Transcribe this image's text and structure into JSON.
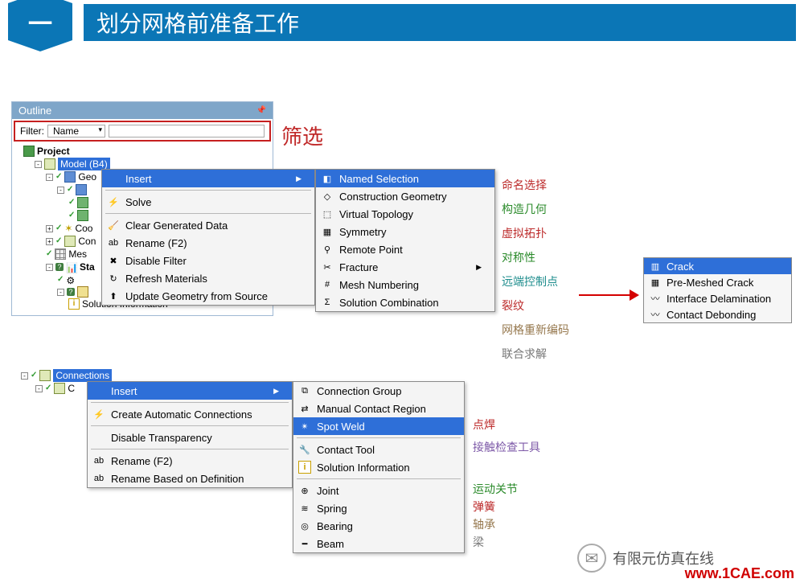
{
  "header": {
    "badge": "一",
    "title": "划分网格前准备工作"
  },
  "outline": {
    "title": "Outline",
    "filter_label": "Filter:",
    "filter_name": "Name",
    "project": "Project",
    "model": "Model (B4)",
    "geo": "Geo",
    "coo": "Coo",
    "con": "Con",
    "mes": "Mes",
    "sta": "Sta",
    "sol_info": "Solution Information"
  },
  "filter_anno": "筛选",
  "menu1": {
    "insert": "Insert",
    "solve": "Solve",
    "clear": "Clear Generated Data",
    "rename": "Rename (F2)",
    "disable_filter": "Disable Filter",
    "refresh": "Refresh Materials",
    "update_geom": "Update Geometry from Source"
  },
  "submenu1": {
    "named_sel": "Named Selection",
    "constr_geom": "Construction Geometry",
    "virt_topo": "Virtual Topology",
    "symmetry": "Symmetry",
    "remote_pt": "Remote Point",
    "fracture": "Fracture",
    "mesh_num": "Mesh Numbering",
    "sol_comb": "Solution Combination"
  },
  "anno1": {
    "named_sel": "命名选择",
    "constr_geom": "构造几何",
    "virt_topo": "虚拟拓扑",
    "symmetry": "对称性",
    "remote_pt": "远端控制点",
    "fracture": "裂纹",
    "mesh_num": "网格重新编码",
    "sol_comb": "联合求解"
  },
  "crack_menu": {
    "crack": "Crack",
    "premesh": "Pre-Meshed Crack",
    "delam": "Interface Delamination",
    "debond": "Contact Debonding"
  },
  "tree2": {
    "connections": "Connections",
    "c": "C"
  },
  "menu2": {
    "insert": "Insert",
    "auto_conn": "Create Automatic Connections",
    "disable_trans": "Disable Transparency",
    "rename": "Rename (F2)",
    "rename_def": "Rename Based on Definition"
  },
  "submenu2": {
    "conn_group": "Connection Group",
    "manual_contact": "Manual Contact Region",
    "spot_weld": "Spot Weld",
    "contact_tool": "Contact Tool",
    "sol_info": "Solution Information",
    "joint": "Joint",
    "spring": "Spring",
    "bearing": "Bearing",
    "beam": "Beam"
  },
  "anno2": {
    "spot_weld": "点焊",
    "contact_tool": "接触检查工具",
    "joint": "运动关节",
    "spring": "弹簧",
    "bearing": "轴承",
    "beam": "梁"
  },
  "footer": {
    "brand": "有限元仿真在线",
    "url": "www.1CAE.com"
  }
}
